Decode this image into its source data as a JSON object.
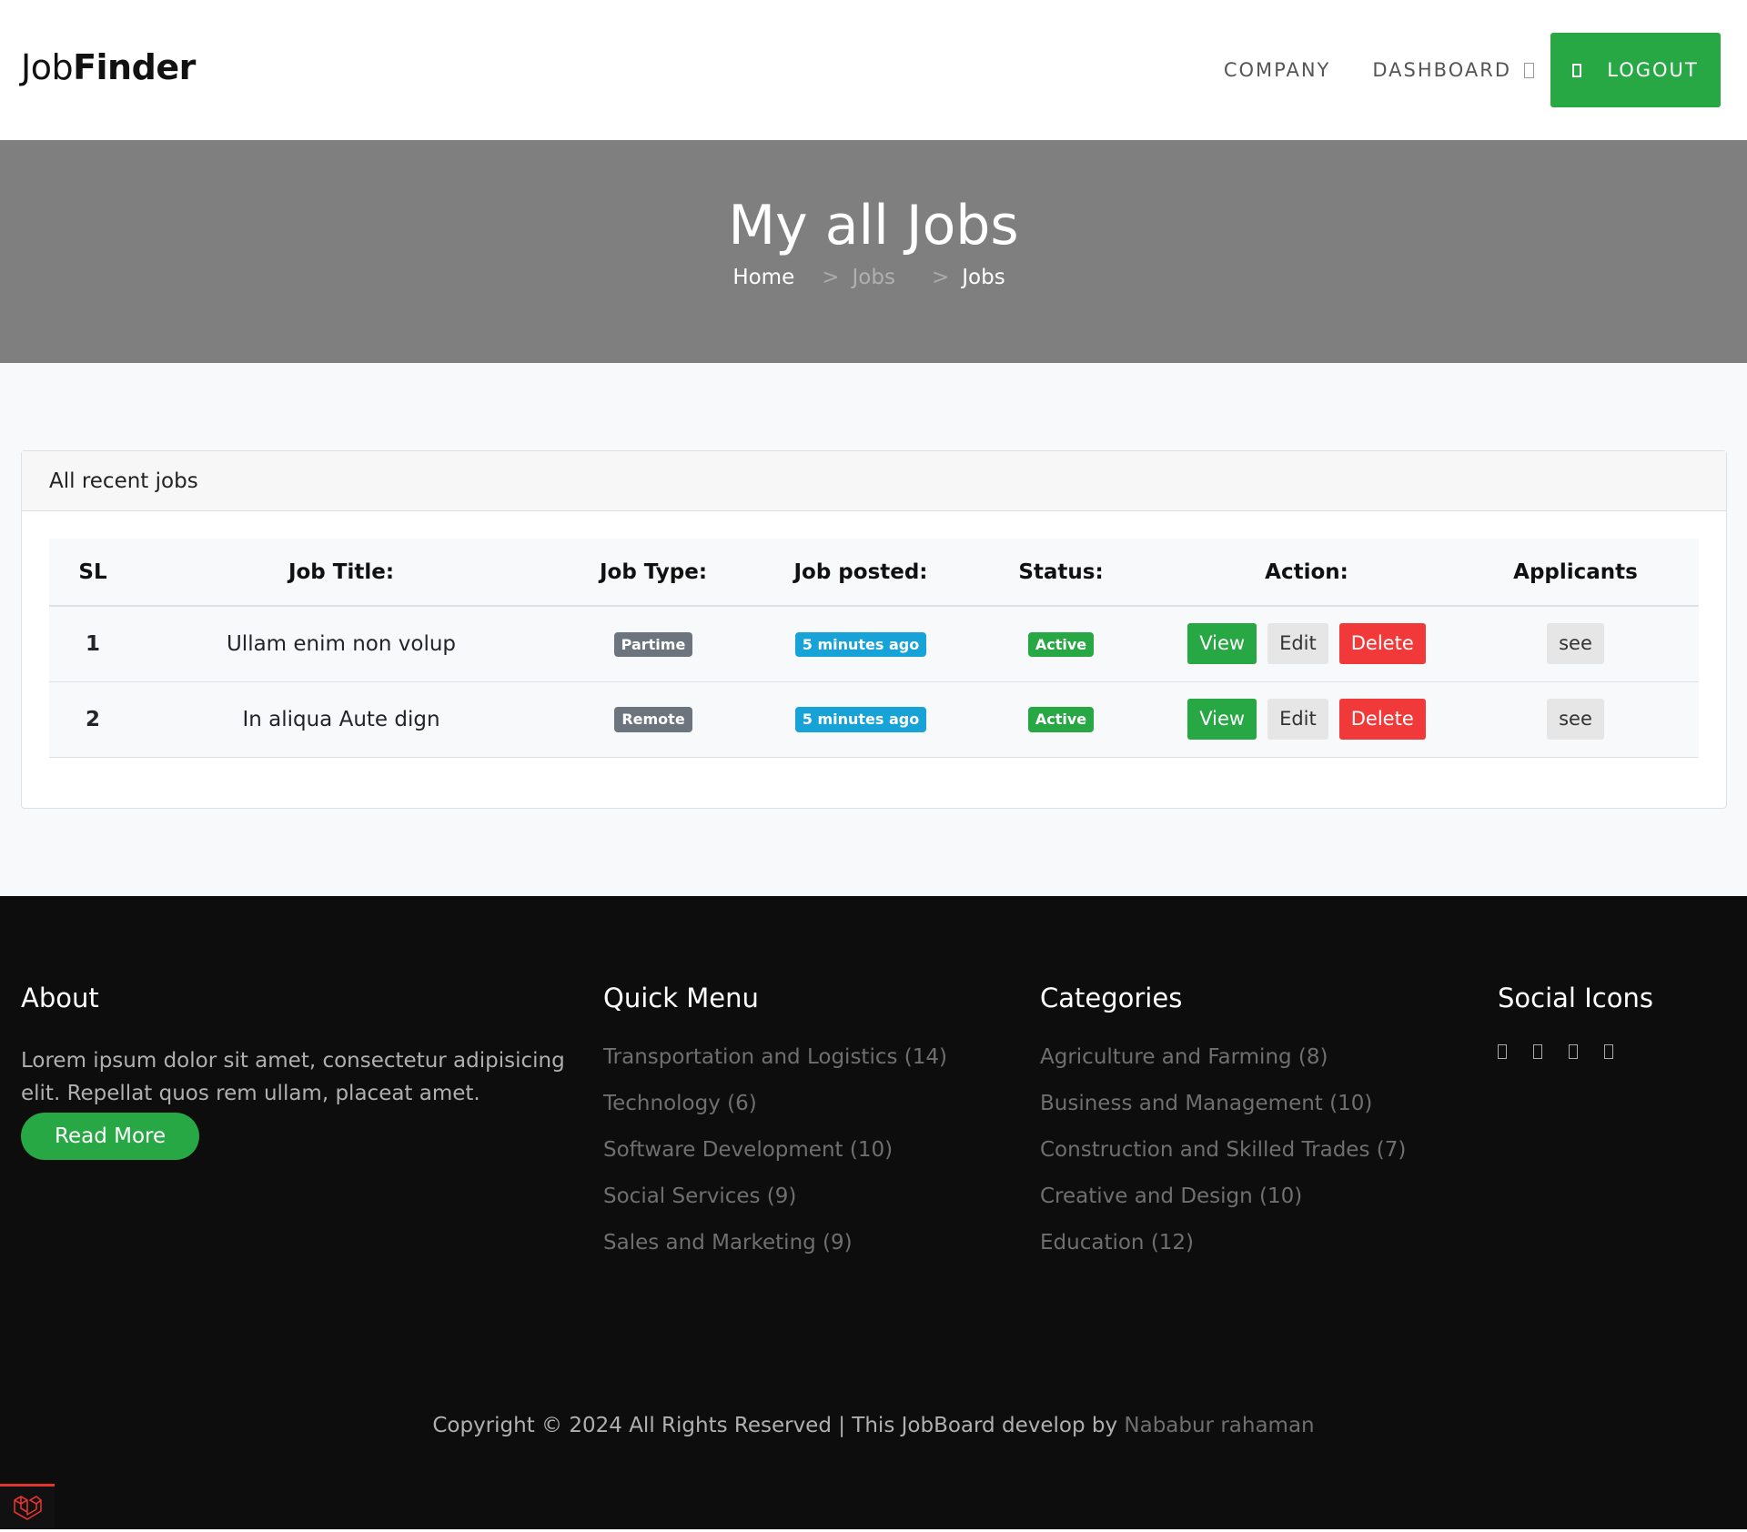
{
  "brand": {
    "light": "Job",
    "bold": "Finder"
  },
  "nav": {
    "company": "COMPANY",
    "dashboard": "DASHBOARD",
    "logout": "LOGOUT"
  },
  "hero": {
    "title": "My all Jobs",
    "breadcrumb": {
      "home": "Home",
      "sep": ">",
      "middle": "Jobs",
      "current": "Jobs"
    }
  },
  "card": {
    "title": "All recent jobs"
  },
  "table": {
    "headers": [
      "SL",
      "Job Title:",
      "Job Type:",
      "Job posted:",
      "Status:",
      "Action:",
      "Applicants"
    ],
    "rows": [
      {
        "sl": "1",
        "title": "Ullam enim non volup",
        "type": "Partime",
        "posted": "5 minutes ago",
        "status": "Active"
      },
      {
        "sl": "2",
        "title": "In aliqua Aute dign",
        "type": "Remote",
        "posted": "5 minutes ago",
        "status": "Active"
      }
    ],
    "actions": {
      "view": "View",
      "edit": "Edit",
      "delete": "Delete",
      "see": "see"
    }
  },
  "footer": {
    "about": {
      "heading": "About",
      "text": "Lorem ipsum dolor sit amet, consectetur adipisicing elit. Repellat quos rem ullam, placeat amet.",
      "button": "Read More"
    },
    "quick_menu": {
      "heading": "Quick Menu",
      "items": [
        "Transportation and Logistics (14)",
        "Technology (6)",
        "Software Development (10)",
        "Social Services (9)",
        "Sales and Marketing (9)"
      ]
    },
    "categories": {
      "heading": "Categories",
      "items": [
        "Agriculture and Farming (8)",
        "Business and Management (10)",
        "Construction and Skilled Trades (7)",
        "Creative and Design (10)",
        "Education (12)"
      ]
    },
    "social": {
      "heading": "Social Icons"
    },
    "copyright": "Copyright © 2024 All Rights Reserved | This JobBoard develop by",
    "author": "Nababur rahaman"
  },
  "colors": {
    "accent_green": "#28a745",
    "danger_red": "#f1393a",
    "info_blue": "#17a2d8",
    "hero_grey": "#7f7f7f",
    "footer_bg": "#0d0d0d"
  }
}
